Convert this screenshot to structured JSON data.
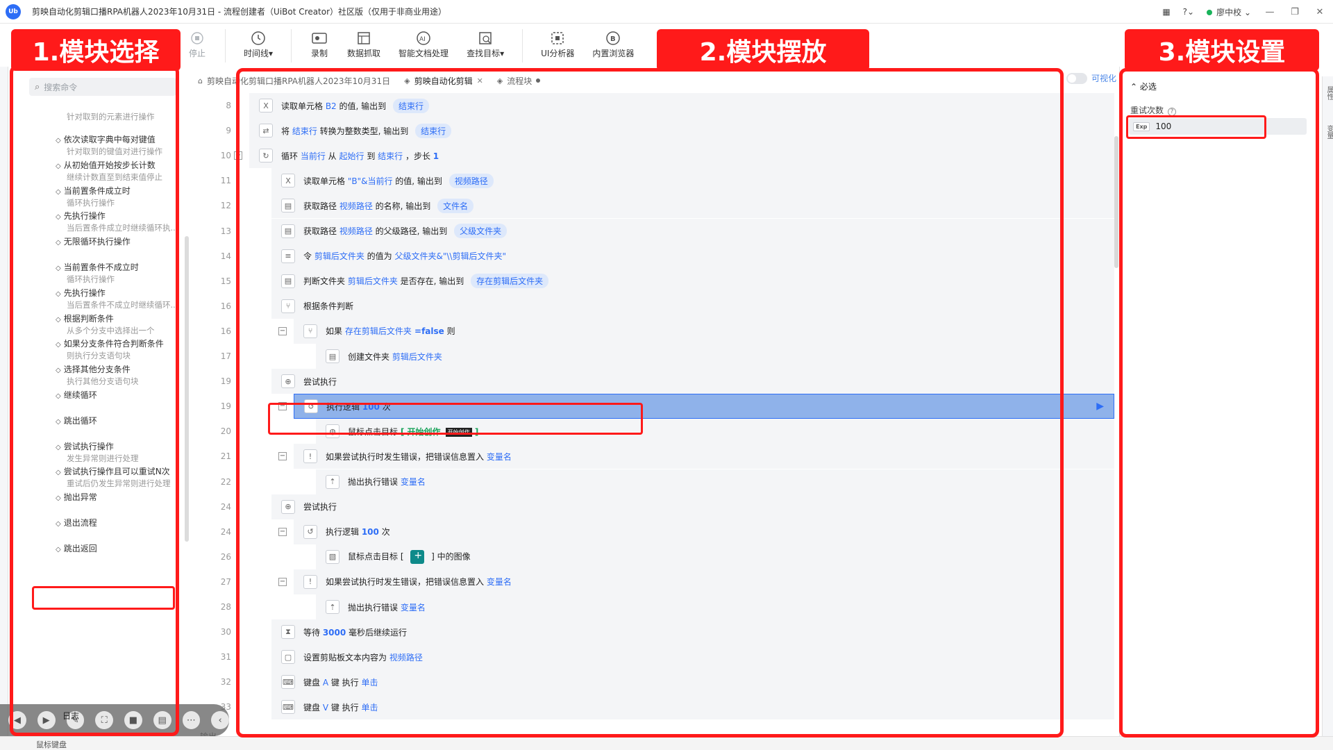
{
  "window": {
    "title": "剪映自动化剪辑口播RPA机器人2023年10月31日 - 流程创建者（UiBot Creator）社区版（仅用于非商业用途）",
    "user": "廖中校",
    "help_label": "?",
    "logo_text": "Ub"
  },
  "toolbar": [
    {
      "label": "停止",
      "icon": "stop-icon",
      "disabled": true
    },
    {
      "label": "时间线▾",
      "icon": "clock-icon",
      "disabled": false
    },
    {
      "label": "录制",
      "icon": "record-icon",
      "disabled": false
    },
    {
      "label": "数据抓取",
      "icon": "data-scrape-icon",
      "disabled": false
    },
    {
      "label": "智能文档处理",
      "icon": "ai-doc-icon",
      "disabled": false
    },
    {
      "label": "查找目标▾",
      "icon": "find-target-icon",
      "disabled": false
    },
    {
      "label": "UI分析器",
      "icon": "ui-analyzer-icon",
      "disabled": false
    },
    {
      "label": "内置浏览器",
      "icon": "browser-icon",
      "disabled": false
    }
  ],
  "annotations": {
    "label1": "1.模块选择",
    "label2": "2.模块摆放",
    "label3": "3.模块设置"
  },
  "left_panel": {
    "search_placeholder": "搜索命令",
    "commands": [
      {
        "title": "",
        "desc": "针对取到的元素进行操作"
      },
      {
        "title": "依次读取字典中每对键值",
        "desc": "针对取到的键值对进行操作"
      },
      {
        "title": "从初始值开始按步长计数",
        "desc": "继续计数直至到结束值停止"
      },
      {
        "title": "当前置条件成立时",
        "desc": "循环执行操作"
      },
      {
        "title": "先执行操作",
        "desc": "当后置条件成立时继续循环执..."
      },
      {
        "title": "无限循环执行操作",
        "desc": ""
      },
      {
        "title": "当前置条件不成立时",
        "desc": "循环执行操作"
      },
      {
        "title": "先执行操作",
        "desc": "当后置条件不成立时继续循环..."
      },
      {
        "title": "根据判断条件",
        "desc": "从多个分支中选择出一个"
      },
      {
        "title": "如果分支条件符合判断条件",
        "desc": "则执行分支语句块"
      },
      {
        "title": "选择其他分支条件",
        "desc": "执行其他分支语句块"
      },
      {
        "title": "继续循环",
        "desc": ""
      },
      {
        "title": "跳出循环",
        "desc": ""
      },
      {
        "title": "尝试执行操作",
        "desc": "发生异常则进行处理"
      },
      {
        "title": "尝试执行操作且可以重试N次",
        "desc": "重试后仍发生异常则进行处理"
      },
      {
        "title": "抛出异常",
        "desc": ""
      },
      {
        "title": "退出流程",
        "desc": ""
      },
      {
        "title": "跳出返回",
        "desc": ""
      }
    ],
    "bottom_label": "日志"
  },
  "tabs": [
    {
      "label": "剪映自动化剪辑口播RPA机器人2023年10月31日",
      "active": false
    },
    {
      "label": "剪映自动化剪辑",
      "active": true
    },
    {
      "label": "流程块",
      "active": false
    }
  ],
  "visualize_label": "可视化",
  "output_label": "输出",
  "bottom_strip_label": "鼠标键盘",
  "editor_rows": [
    {
      "ln": "8",
      "indent": 0,
      "icon": "excel-icon",
      "parts": [
        [
          "t",
          "读取单元格 "
        ],
        [
          "v",
          "B2"
        ],
        [
          "t",
          " 的值, 输出到 "
        ],
        [
          "o",
          "结束行"
        ]
      ]
    },
    {
      "ln": "9",
      "indent": 0,
      "icon": "convert-icon",
      "parts": [
        [
          "t",
          "将 "
        ],
        [
          "v",
          "结束行"
        ],
        [
          "t",
          " 转换为整数类型, 输出到 "
        ],
        [
          "o",
          "结束行"
        ]
      ]
    },
    {
      "ln": "10",
      "indent": 0,
      "icon": "loop-icon",
      "collapse": true,
      "parts": [
        [
          "t",
          "循环 "
        ],
        [
          "v",
          "当前行"
        ],
        [
          "t",
          " 从 "
        ],
        [
          "v",
          "起始行"
        ],
        [
          "t",
          " 到 "
        ],
        [
          "v",
          "结束行"
        ],
        [
          "t",
          " ，步长 "
        ],
        [
          "b",
          "1"
        ]
      ]
    },
    {
      "ln": "11",
      "indent": 1,
      "icon": "excel-icon",
      "parts": [
        [
          "t",
          "读取单元格 "
        ],
        [
          "v",
          "\"B\"&当前行"
        ],
        [
          "t",
          " 的值, 输出到 "
        ],
        [
          "o",
          "视频路径"
        ]
      ]
    },
    {
      "ln": "12",
      "indent": 1,
      "icon": "file-icon",
      "parts": [
        [
          "t",
          "获取路径 "
        ],
        [
          "v",
          "视频路径"
        ],
        [
          "t",
          " 的名称, 输出到 "
        ],
        [
          "o",
          "文件名"
        ]
      ]
    },
    {
      "ln": "13",
      "indent": 1,
      "icon": "file-icon",
      "parts": [
        [
          "t",
          "获取路径 "
        ],
        [
          "v",
          "视频路径"
        ],
        [
          "t",
          " 的父级路径, 输出到 "
        ],
        [
          "o",
          "父级文件夹"
        ]
      ]
    },
    {
      "ln": "14",
      "indent": 1,
      "icon": "assign-icon",
      "parts": [
        [
          "t",
          "令 "
        ],
        [
          "v",
          "剪辑后文件夹"
        ],
        [
          "t",
          " 的值为 "
        ],
        [
          "v",
          "父级文件夹&\"\\\\剪辑后文件夹\""
        ]
      ]
    },
    {
      "ln": "15",
      "indent": 1,
      "icon": "file-icon",
      "parts": [
        [
          "t",
          "判断文件夹 "
        ],
        [
          "v",
          "剪辑后文件夹"
        ],
        [
          "t",
          " 是否存在, 输出到 "
        ],
        [
          "o",
          "存在剪辑后文件夹"
        ]
      ]
    },
    {
      "ln": "16",
      "indent": 1,
      "icon": "branch-icon",
      "parts": [
        [
          "t",
          "根据条件判断"
        ]
      ]
    },
    {
      "ln": "16",
      "indent": 2,
      "icon": "branch-icon",
      "collapse": true,
      "parts": [
        [
          "t",
          "如果 "
        ],
        [
          "v",
          "存在剪辑后文件夹"
        ],
        [
          "b",
          " =false"
        ],
        [
          "t",
          " 则"
        ]
      ]
    },
    {
      "ln": "17",
      "indent": 3,
      "icon": "file-icon",
      "parts": [
        [
          "t",
          "创建文件夹 "
        ],
        [
          "v",
          "剪辑后文件夹"
        ]
      ]
    },
    {
      "ln": "19",
      "indent": 1,
      "icon": "try-icon",
      "parts": [
        [
          "t",
          "尝试执行"
        ]
      ]
    },
    {
      "ln": "19",
      "indent": 2,
      "icon": "retry-icon",
      "collapse": true,
      "selected": true,
      "parts": [
        [
          "t",
          "执行逻辑 "
        ],
        [
          "b",
          "100"
        ],
        [
          "t",
          " 次"
        ]
      ]
    },
    {
      "ln": "20",
      "indent": 3,
      "icon": "mouse-icon",
      "parts": [
        [
          "t",
          "鼠标点击目标 "
        ],
        [
          "g",
          "[ 开始创作 "
        ],
        [
          "i",
          "开始创作"
        ],
        [
          "g",
          " ]"
        ]
      ]
    },
    {
      "ln": "21",
      "indent": 2,
      "icon": "catch-icon",
      "collapse": true,
      "parts": [
        [
          "t",
          "如果尝试执行时发生错误，把错误信息置入 "
        ],
        [
          "v",
          "变量名"
        ]
      ]
    },
    {
      "ln": "22",
      "indent": 3,
      "icon": "throw-icon",
      "parts": [
        [
          "t",
          "抛出执行错误 "
        ],
        [
          "v",
          "变量名"
        ]
      ]
    },
    {
      "ln": "24",
      "indent": 1,
      "icon": "try-icon",
      "parts": [
        [
          "t",
          "尝试执行"
        ]
      ]
    },
    {
      "ln": "24",
      "indent": 2,
      "icon": "retry-icon",
      "collapse": true,
      "parts": [
        [
          "t",
          "执行逻辑 "
        ],
        [
          "b",
          "100"
        ],
        [
          "t",
          " 次"
        ]
      ]
    },
    {
      "ln": "26",
      "indent": 3,
      "icon": "image-icon",
      "parts": [
        [
          "t",
          "鼠标点击目标 [ "
        ],
        [
          "m",
          ""
        ],
        [
          "t",
          " ] 中的图像"
        ]
      ]
    },
    {
      "ln": "27",
      "indent": 2,
      "icon": "catch-icon",
      "collapse": true,
      "parts": [
        [
          "t",
          "如果尝试执行时发生错误，把错误信息置入 "
        ],
        [
          "v",
          "变量名"
        ]
      ]
    },
    {
      "ln": "28",
      "indent": 3,
      "icon": "throw-icon",
      "parts": [
        [
          "t",
          "抛出执行错误 "
        ],
        [
          "v",
          "变量名"
        ]
      ]
    },
    {
      "ln": "30",
      "indent": 1,
      "icon": "delay-icon",
      "parts": [
        [
          "t",
          "等待 "
        ],
        [
          "b",
          "3000"
        ],
        [
          "t",
          " 毫秒后继续运行"
        ]
      ]
    },
    {
      "ln": "31",
      "indent": 1,
      "icon": "clipboard-icon",
      "parts": [
        [
          "t",
          "设置剪贴板文本内容为 "
        ],
        [
          "v",
          "视频路径"
        ]
      ]
    },
    {
      "ln": "32",
      "indent": 1,
      "icon": "keyboard-icon",
      "parts": [
        [
          "t",
          "键盘 "
        ],
        [
          "v",
          "A"
        ],
        [
          "t",
          " 键 执行 "
        ],
        [
          "v",
          "单击"
        ]
      ]
    },
    {
      "ln": "33",
      "indent": 1,
      "icon": "keyboard-icon",
      "parts": [
        [
          "t",
          "键盘 "
        ],
        [
          "v",
          "V"
        ],
        [
          "t",
          " 键 执行 "
        ],
        [
          "v",
          "单击"
        ]
      ]
    }
  ],
  "right_panel": {
    "section": "必选",
    "retry_label": "重试次数",
    "exp_badge": "Exp",
    "retry_value": "100",
    "edge_labels": [
      "属性",
      "变量"
    ]
  },
  "colors": {
    "accent": "#2d6df6",
    "annotation_red": "#ff1a1a",
    "selected_row": "#8fb2ea"
  }
}
